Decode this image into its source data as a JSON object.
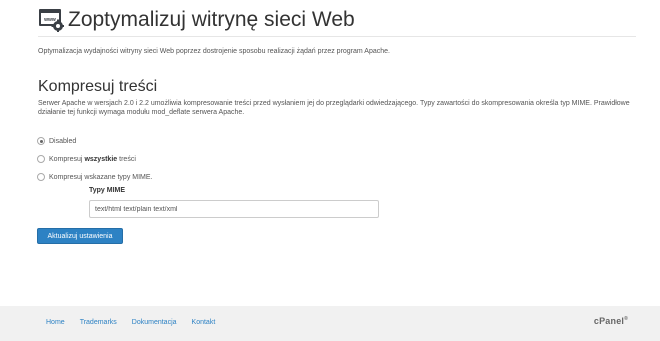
{
  "page": {
    "title": "Zoptymalizuj witrynę sieci Web",
    "icon": "www-gear-icon",
    "intro": "Optymalizacja wydajności witryny sieci Web poprzez dostrojenie sposobu realizacji żądań przez program Apache."
  },
  "compress": {
    "title": "Kompresuj treści",
    "description": "Serwer Apache w wersjach 2.0 i 2.2 umożliwia kompresowanie treści przed wysłaniem jej do przeglądarki odwiedzającego. Typy zawartości do skompresowania określa typ MIME. Prawidłowe działanie tej funkcji wymaga modułu mod_deflate serwera Apache.",
    "options": [
      {
        "label": "Disabled",
        "checked": true
      },
      {
        "prefix": "Kompresuj",
        "bold": "wszystkie",
        "suffix": "treści",
        "checked": false
      },
      {
        "label": "Kompresuj wskazane typy MIME.",
        "checked": false
      }
    ],
    "mime_label": "Typy MIME",
    "mime_value": "text/html text/plain text/xml",
    "submit_label": "Aktualizuj ustawienia"
  },
  "footer": {
    "links": [
      "Home",
      "Trademarks",
      "Dokumentacja",
      "Kontakt"
    ],
    "logo": "cPanel",
    "logo_mark": "®"
  },
  "colors": {
    "accent": "#2d82c4",
    "footer_bg": "#f1f1f1"
  }
}
